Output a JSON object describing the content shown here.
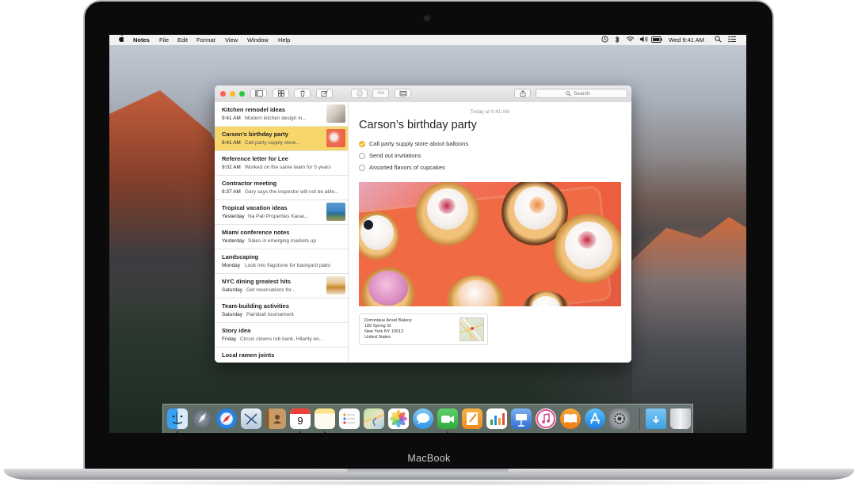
{
  "menubar": {
    "app_name": "Notes",
    "items": [
      "File",
      "Edit",
      "Format",
      "View",
      "Window",
      "Help"
    ],
    "clock": "Wed 9:41 AM"
  },
  "toolbar": {
    "format_label": "Aa",
    "search_placeholder": "Search"
  },
  "notes": [
    {
      "title": "Kitchen remodel ideas",
      "date": "9:41 AM",
      "preview": "Modern kitchen design in..."
    },
    {
      "title": "Carson’s birthday party",
      "date": "9:41 AM",
      "preview": "Call party supply store..."
    },
    {
      "title": "Reference letter for Lee",
      "date": "9:02 AM",
      "preview": "Worked on the same team for 5 years"
    },
    {
      "title": "Contractor meeting",
      "date": "8:37 AM",
      "preview": "Gary says the inspector will not be able..."
    },
    {
      "title": "Tropical vacation ideas",
      "date": "Yesterday",
      "preview": "Na Pali Properties Kauai..."
    },
    {
      "title": "Miami conference notes",
      "date": "Yesterday",
      "preview": "Sales in emerging markets up"
    },
    {
      "title": "Landscaping",
      "date": "Monday",
      "preview": "Look into flagstone for backyard patio"
    },
    {
      "title": "NYC dining greatest hits",
      "date": "Saturday",
      "preview": "Get reservations for..."
    },
    {
      "title": "Team-building activities",
      "date": "Saturday",
      "preview": "Paintball tournament"
    },
    {
      "title": "Story idea",
      "date": "Friday",
      "preview": "Circus clowns rob bank. Hilarity en..."
    },
    {
      "title": "Local ramen joints",
      "date": "",
      "preview": ""
    }
  ],
  "editor": {
    "date": "Today at 9:41 AM",
    "title": "Carson’s birthday party",
    "checklist": [
      {
        "text": "Call party supply store about balloons",
        "done": true
      },
      {
        "text": "Send out invitations",
        "done": false
      },
      {
        "text": "Assorted flavors of cupcakes",
        "done": false
      }
    ],
    "map_card": {
      "line1": "Dominique Ansel Bakery",
      "line2": "189 Spring St",
      "line3": "New York NY 10012",
      "line4": "United States"
    }
  },
  "dock": {
    "calendar_day": "9",
    "apps": [
      "finder-icon",
      "launchpad-icon",
      "safari-icon",
      "mail-icon",
      "contacts-icon",
      "calendar-icon",
      "notes-icon",
      "reminders-icon",
      "maps-icon",
      "photos-icon",
      "messages-icon",
      "facetime-icon",
      "pages-icon",
      "numbers-icon",
      "keynote-icon",
      "itunes-icon",
      "ibooks-icon",
      "app-store-icon",
      "system-preferences-icon",
      "downloads-folder-icon",
      "trash-icon"
    ]
  },
  "device_label": "MacBook",
  "colors": {
    "note_selected": "#f7d66c",
    "checkbox_done": "#f3b628",
    "traffic_close": "#fc5f57",
    "traffic_min": "#fdbc2e",
    "traffic_max": "#29c940"
  }
}
